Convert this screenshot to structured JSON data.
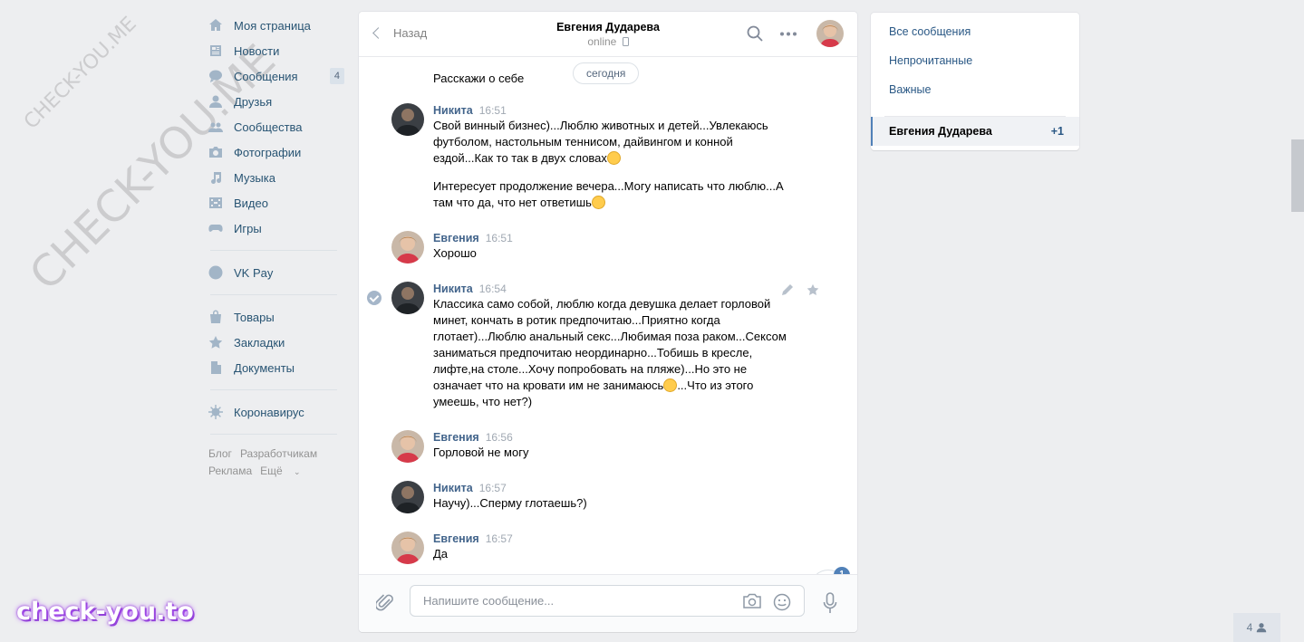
{
  "watermarks": {
    "small": "CHECK-YOU.ME",
    "large": "CHECK-YOU.ME",
    "bottom_logo": "check-you.to"
  },
  "sidebar": {
    "items": [
      {
        "label": "Моя страница",
        "icon": "home-icon"
      },
      {
        "label": "Новости",
        "icon": "news-icon"
      },
      {
        "label": "Сообщения",
        "icon": "messages-icon",
        "count": "4"
      },
      {
        "label": "Друзья",
        "icon": "friends-icon"
      },
      {
        "label": "Сообщества",
        "icon": "groups-icon"
      },
      {
        "label": "Фотографии",
        "icon": "camera-icon"
      },
      {
        "label": "Музыка",
        "icon": "music-icon"
      },
      {
        "label": "Видео",
        "icon": "video-icon"
      },
      {
        "label": "Игры",
        "icon": "games-icon"
      }
    ],
    "pay": {
      "label": "VK Pay",
      "icon": "vkpay-icon"
    },
    "items2": [
      {
        "label": "Товары",
        "icon": "bag-icon"
      },
      {
        "label": "Закладки",
        "icon": "star-icon"
      },
      {
        "label": "Документы",
        "icon": "document-icon"
      }
    ],
    "corona": {
      "label": "Коронавирус",
      "icon": "virus-icon"
    },
    "footer": {
      "blog": "Блог",
      "dev": "Разработчикам",
      "ads": "Реклама",
      "more": "Ещё"
    }
  },
  "chat": {
    "back_label": "Назад",
    "peer_name": "Евгения Дударева",
    "peer_status": "online",
    "date_pill": "сегодня",
    "prev_text": "Расскажи о себе",
    "messages": [
      {
        "author": "Никита",
        "time": "16:51",
        "p1": "Свой винный бизнес)...Люблю животных и детей...Увлекаюсь футболом, настольным теннисом, дайвингом и конной ездой...Как то так в двух словах",
        "p2": "Интересует продолжение вечера...Могу написать что люблю...А там что да, что нет ответишь"
      },
      {
        "author": "Евгения",
        "time": "16:51",
        "text": "Хорошо"
      },
      {
        "author": "Никита",
        "time": "16:54",
        "text_a": "Классика само собой, люблю когда девушка делает горловой минет, кончать в ротик предпочитаю...Приятно когда глотает)...Люблю анальный секс...Любимая поза раком...Сексом заниматься предпочитаю неординарно...Тобишь в кресле, лифте,на столе...Хочу попробовать на пляже)...Но это не означает что на кровати им не занимаюсь",
        "text_b": "...Что из этого умеешь, что нет?)"
      },
      {
        "author": "Евгения",
        "time": "16:56",
        "text": "Горловой не могу"
      },
      {
        "author": "Никита",
        "time": "16:57",
        "text": "Научу)...Сперму глотаешь?)"
      },
      {
        "author": "Евгения",
        "time": "16:57",
        "text": "Да"
      }
    ],
    "unread_badge": "1",
    "composer_placeholder": "Напишите сообщение..."
  },
  "right_panel": {
    "all": "Все сообщения",
    "unread": "Непрочитанные",
    "important": "Важные",
    "active_name": "Евгения Дударева",
    "active_count": "+1"
  },
  "friends_online": "4",
  "colors": {
    "link": "#2a5885",
    "author": "#42648b",
    "accent": "#5181b8",
    "bg": "#edeef0"
  }
}
